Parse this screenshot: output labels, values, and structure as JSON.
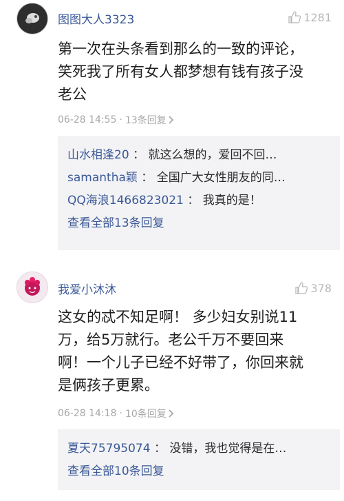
{
  "comments": [
    {
      "username": "图图大人3323",
      "avatar_icon": "avatar-icon",
      "likes": "1281",
      "text": "第一次在头条看到那么的一致的评论，\n笑死我了所有女人都梦想有钱有孩子没\n老公",
      "time": "06-28 14:55",
      "dot": "·",
      "reply_count": "13条回复",
      "replies": [
        {
          "name": "山水相逢20",
          "sep": "：",
          "text": "就这么想的，爱回不回…"
        },
        {
          "name": "samantha颖",
          "sep": "：",
          "text": "全国广大女性朋友的同…"
        },
        {
          "name": "QQ海浪1466823021",
          "sep": "：",
          "text": "我真的是！"
        }
      ],
      "view_all": "查看全部13条回复"
    },
    {
      "username": "我爱小沐沐",
      "avatar_icon": "avatar-icon",
      "likes": "378",
      "text": "这女的忒不知足啊！ 多少妇女别说11\n万，给5万就行。老公千万不要回来\n啊！一个儿子已经不好带了，你回来就\n是俩孩子更累。",
      "time": "06-28 14:18",
      "dot": "·",
      "reply_count": "10条回复",
      "replies": [
        {
          "name": "夏天75795074",
          "sep": "：",
          "text": "没错，我也觉得是在…"
        }
      ],
      "view_all": "查看全部10条回复"
    }
  ],
  "colors": {
    "link": "#3b5998",
    "muted": "#a8a8a8",
    "reply_bg": "#f3f3f5"
  }
}
